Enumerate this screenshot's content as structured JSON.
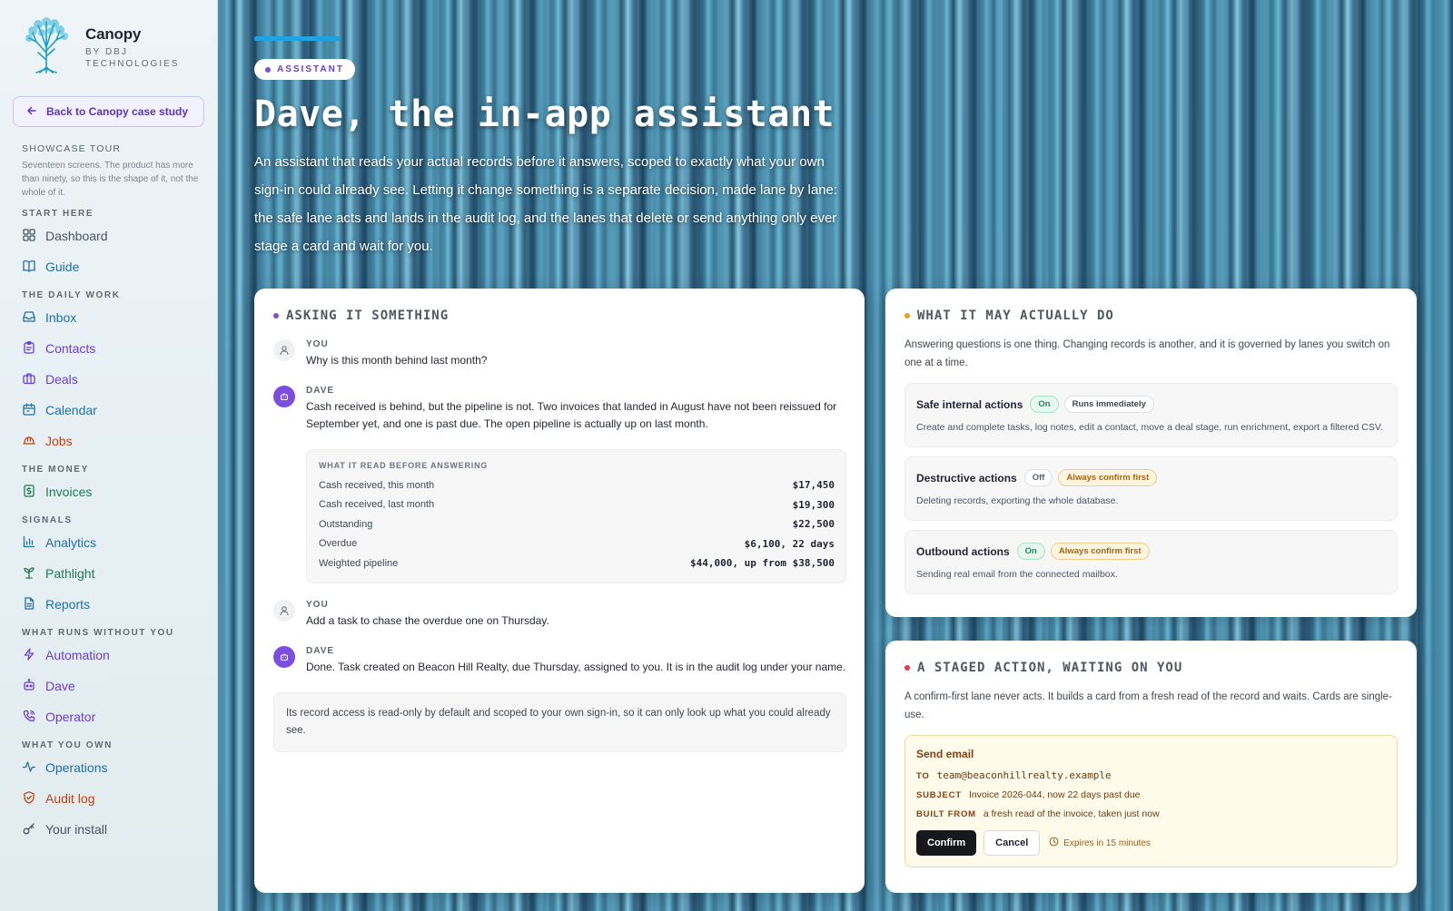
{
  "brand": {
    "name": "Canopy",
    "sub": "BY DBJ TECHNOLOGIES",
    "logo_icon": "tree-icon"
  },
  "back_link": {
    "label": "Back to Canopy case study",
    "icon": "arrow-left-icon"
  },
  "tour": {
    "title": "SHOWCASE TOUR",
    "description": "Seventeen screens. The product has more than ninety, so this is the shape of it, not the whole of it."
  },
  "nav": [
    {
      "heading": "START HERE",
      "items": [
        {
          "label": "Dashboard",
          "icon": "grid-icon",
          "color": "#475561"
        },
        {
          "label": "Guide",
          "icon": "book-icon",
          "color": "#1f6fa8"
        }
      ]
    },
    {
      "heading": "THE DAILY WORK",
      "items": [
        {
          "label": "Inbox",
          "icon": "inbox-icon",
          "color": "#1f6fa8"
        },
        {
          "label": "Contacts",
          "icon": "clipboard-icon",
          "color": "#6a3fd2"
        },
        {
          "label": "Deals",
          "icon": "briefcase-icon",
          "color": "#6a3fd2"
        },
        {
          "label": "Calendar",
          "icon": "calendar-icon",
          "color": "#1f6fa8"
        },
        {
          "label": "Jobs",
          "icon": "hardhat-icon",
          "color": "#c2410c"
        }
      ]
    },
    {
      "heading": "THE MONEY",
      "items": [
        {
          "label": "Invoices",
          "icon": "receipt-icon",
          "color": "#1f7a52"
        }
      ]
    },
    {
      "heading": "SIGNALS",
      "items": [
        {
          "label": "Analytics",
          "icon": "bar-chart-icon",
          "color": "#1f6fa8"
        },
        {
          "label": "Pathlight",
          "icon": "sprout-icon",
          "color": "#1f7a52"
        },
        {
          "label": "Reports",
          "icon": "file-icon",
          "color": "#1f6fa8"
        }
      ]
    },
    {
      "heading": "WHAT RUNS WITHOUT YOU",
      "items": [
        {
          "label": "Automation",
          "icon": "zap-icon",
          "color": "#6a3fd2"
        },
        {
          "label": "Dave",
          "icon": "bot-icon",
          "color": "#6a3fd2"
        },
        {
          "label": "Operator",
          "icon": "phone-icon",
          "color": "#6a3fd2"
        }
      ]
    },
    {
      "heading": "WHAT YOU OWN",
      "items": [
        {
          "label": "Operations",
          "icon": "activity-icon",
          "color": "#1f6fa8"
        },
        {
          "label": "Audit log",
          "icon": "shield-icon",
          "color": "#c2410c"
        },
        {
          "label": "Your install",
          "icon": "key-icon",
          "color": "#475561"
        }
      ]
    }
  ],
  "hero": {
    "pill": "ASSISTANT",
    "title": "Dave, the in-app assistant",
    "lede": "An assistant that reads your actual records before it answers, scoped to exactly what your own sign-in could already see. Letting it change something is a separate decision, made lane by lane: the safe lane acts and lands in the audit log, and the lanes that delete or send anything only ever stage a card and wait for you."
  },
  "chat": {
    "heading": "ASKING IT SOMETHING",
    "you_label": "YOU",
    "dave_label": "DAVE",
    "q1": "Why is this month behind last month?",
    "a1": "Cash received is behind, but the pipeline is not. Two invoices that landed in August have not been reissued for September yet, and one is past due. The open pipeline is actually up on last month.",
    "read_title": "WHAT IT READ BEFORE ANSWERING",
    "read_rows": [
      {
        "label": "Cash received, this month",
        "value": "$17,450"
      },
      {
        "label": "Cash received, last month",
        "value": "$19,300"
      },
      {
        "label": "Outstanding",
        "value": "$22,500"
      },
      {
        "label": "Overdue",
        "value": "$6,100, 22 days"
      },
      {
        "label": "Weighted pipeline",
        "value": "$44,000, up from $38,500"
      }
    ],
    "q2": "Add a task to chase the overdue one on Thursday.",
    "a2": "Done. Task created on Beacon Hill Realty, due Thursday, assigned to you. It is in the audit log under your name.",
    "note": "Its record access is read-only by default and scoped to your own sign-in, so it can only look up what you could already see."
  },
  "lanes": {
    "heading": "WHAT IT MAY ACTUALLY DO",
    "intro": "Answering questions is one thing. Changing records is another, and it is governed by lanes you switch on one at a time.",
    "items": [
      {
        "name": "Safe internal actions",
        "state": "On",
        "mode": "Runs immediately",
        "desc": "Create and complete tasks, log notes, edit a contact, move a deal stage, run enrichment, export a filtered CSV."
      },
      {
        "name": "Destructive actions",
        "state": "Off",
        "mode": "Always confirm first",
        "desc": "Deleting records, exporting the whole database."
      },
      {
        "name": "Outbound actions",
        "state": "On",
        "mode": "Always confirm first",
        "desc": "Sending real email from the connected mailbox."
      }
    ]
  },
  "staged": {
    "heading": "A STAGED ACTION, WAITING ON YOU",
    "intro": "A confirm-first lane never acts. It builds a card from a fresh read of the record and waits. Cards are single-use.",
    "card_title": "Send email",
    "to_label": "TO",
    "to_value": "team@beaconhillrealty.example",
    "subject_label": "SUBJECT",
    "subject_value": "Invoice 2026-044, now 22 days past due",
    "built_label": "BUILT FROM",
    "built_value": "a fresh read of the invoice, taken just now",
    "confirm": "Confirm",
    "cancel": "Cancel",
    "expires": "Expires in 15 minutes"
  },
  "colors": {
    "accent": "#7d4ce0",
    "chat_dot": "#7d4ce0",
    "lanes_dot": "#e8a21c",
    "staged_dot": "#e0374b",
    "hero_bar": "#1fa2e0"
  }
}
